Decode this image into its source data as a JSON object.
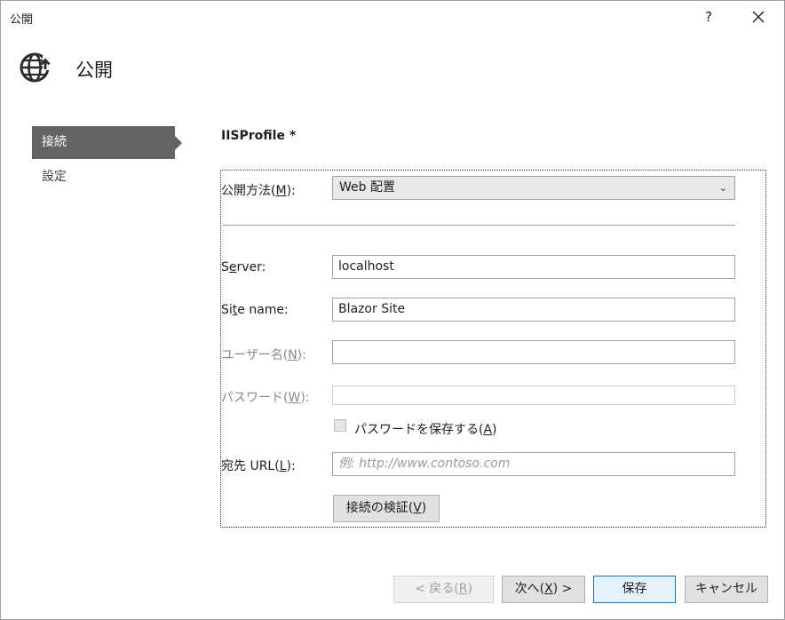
{
  "window": {
    "title": "公開",
    "help_label": "?"
  },
  "header": {
    "title": "公開",
    "icon": "globe-publish-icon"
  },
  "nav": {
    "items": [
      {
        "label": "接続",
        "active": true
      },
      {
        "label": "設定",
        "active": false
      }
    ]
  },
  "profile": {
    "title": "IISProfile *"
  },
  "form": {
    "method": {
      "label_pre": "公開方法(",
      "label_key": "M",
      "label_post": "):",
      "value": "Web 配置"
    },
    "server": {
      "label_pre": "S",
      "label_key": "e",
      "label_post": "rver:",
      "value": "localhost"
    },
    "site": {
      "label_pre": "Si",
      "label_key": "t",
      "label_post": "e name:",
      "value": "Blazor Site"
    },
    "username": {
      "label_pre": "ユーザー名(",
      "label_key": "N",
      "label_post": "):",
      "value": ""
    },
    "password": {
      "label_pre": "パスワード(",
      "label_key": "W",
      "label_post": "):",
      "value": ""
    },
    "save_password": {
      "label_pre": "パスワードを保存する(",
      "label_key": "A",
      "label_post": ")",
      "checked": false
    },
    "dest_url": {
      "label_pre": "宛先 URL(",
      "label_key": "L",
      "label_post": "):",
      "placeholder": "例: http://www.contoso.com"
    },
    "validate": {
      "label_pre": "接続の検証(",
      "label_key": "V",
      "label_post": ")"
    }
  },
  "footer": {
    "back": {
      "label_pre": "< 戻る(",
      "label_key": "R",
      "label_post": ")"
    },
    "next": {
      "label_pre": "次へ(",
      "label_key": "X",
      "label_post": ") >"
    },
    "save": {
      "label": "保存"
    },
    "cancel": {
      "label": "キャンセル"
    }
  }
}
